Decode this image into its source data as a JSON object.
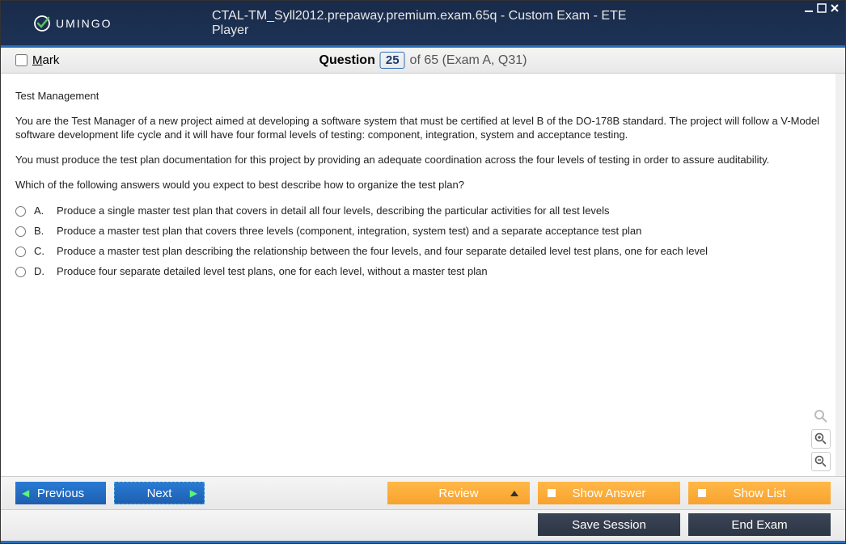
{
  "window": {
    "title": "CTAL-TM_Syll2012.prepaway.premium.exam.65q - Custom Exam - ETE Player",
    "logo_text": "UMINGO"
  },
  "question_bar": {
    "mark_label": "Mark",
    "question_label": "Question",
    "current": "25",
    "total_text": "of 65 (Exam A, Q31)"
  },
  "content": {
    "category": "Test Management",
    "p1": "You are the Test Manager of a new project aimed at developing a software system that must be certified at level B of the DO-178B standard. The project will follow a V-Model software development life cycle and it will have four formal levels of testing: component, integration, system and acceptance testing.",
    "p2": "You must produce the test plan documentation for this project by providing an adequate coordination across the four levels of testing in order to assure auditability.",
    "p3": "Which of the following answers would you expect to best describe how to organize the test plan?",
    "options": [
      {
        "letter": "A.",
        "text": "Produce a single master test plan that covers in detail all four levels, describing the particular activities for all test levels"
      },
      {
        "letter": "B.",
        "text": "Produce a master test plan that covers three levels (component, integration, system test) and a separate acceptance test plan"
      },
      {
        "letter": "C.",
        "text": "Produce a master test plan describing the relationship between the four levels, and four separate detailed level test plans, one for each level"
      },
      {
        "letter": "D.",
        "text": "Produce four separate detailed level test plans, one for each level, without a master test plan"
      }
    ]
  },
  "toolbar": {
    "previous": "Previous",
    "next": "Next",
    "review": "Review",
    "show_answer": "Show Answer",
    "show_list": "Show List",
    "save_session": "Save Session",
    "end_exam": "End Exam"
  }
}
